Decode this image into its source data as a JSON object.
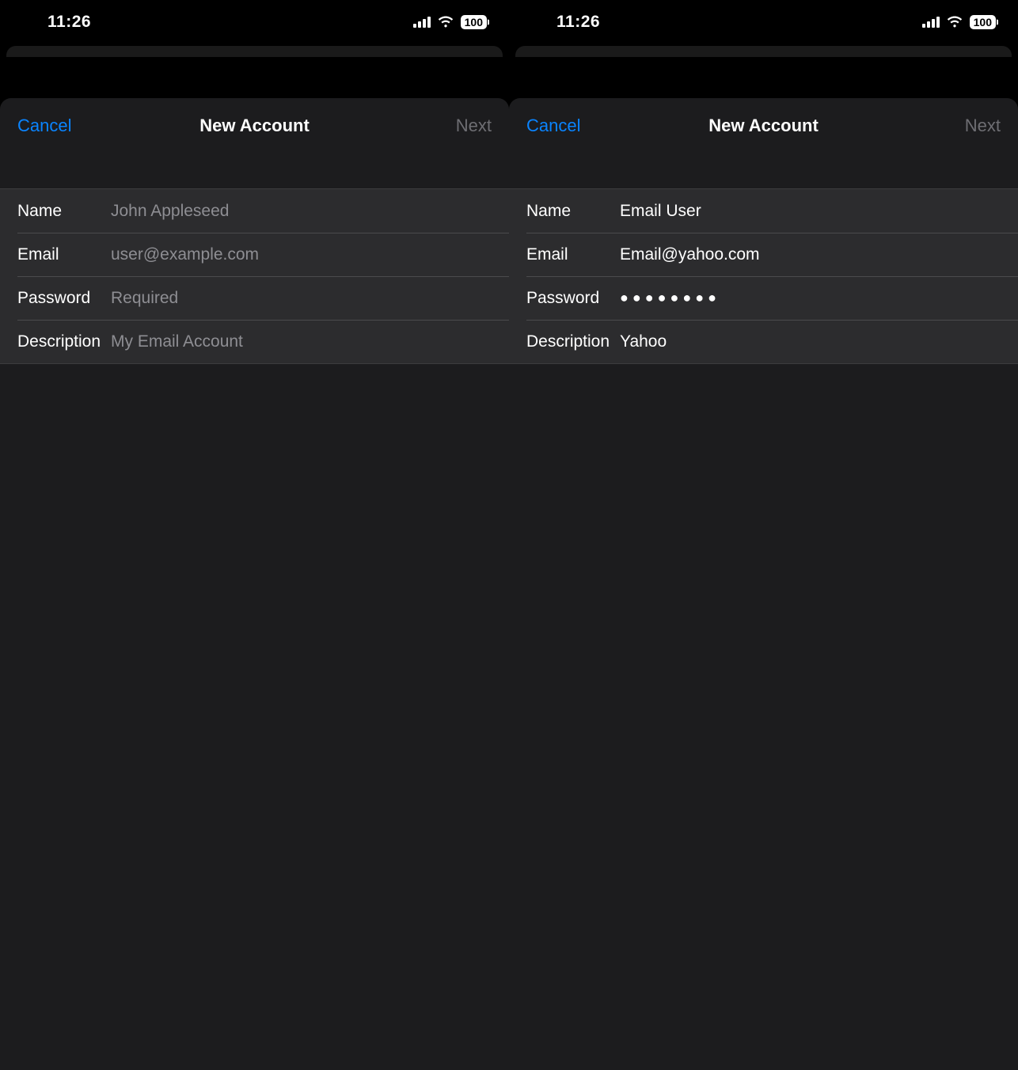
{
  "screens": [
    {
      "status": {
        "time": "11:26",
        "battery": "100"
      },
      "nav": {
        "cancel": "Cancel",
        "title": "New Account",
        "next": "Next"
      },
      "fields": {
        "name": {
          "label": "Name",
          "placeholder": "John Appleseed",
          "value": ""
        },
        "email": {
          "label": "Email",
          "placeholder": "user@example.com",
          "value": ""
        },
        "password": {
          "label": "Password",
          "placeholder": "Required",
          "value": ""
        },
        "description": {
          "label": "Description",
          "placeholder": "My Email Account",
          "value": ""
        }
      }
    },
    {
      "status": {
        "time": "11:26",
        "battery": "100"
      },
      "nav": {
        "cancel": "Cancel",
        "title": "New Account",
        "next": "Next"
      },
      "fields": {
        "name": {
          "label": "Name",
          "placeholder": "",
          "value": "Email User"
        },
        "email": {
          "label": "Email",
          "placeholder": "",
          "value": "Email@yahoo.com"
        },
        "password": {
          "label": "Password",
          "placeholder": "",
          "value": "●●●●●●●●"
        },
        "description": {
          "label": "Description",
          "placeholder": "",
          "value": "Yahoo"
        }
      }
    }
  ]
}
